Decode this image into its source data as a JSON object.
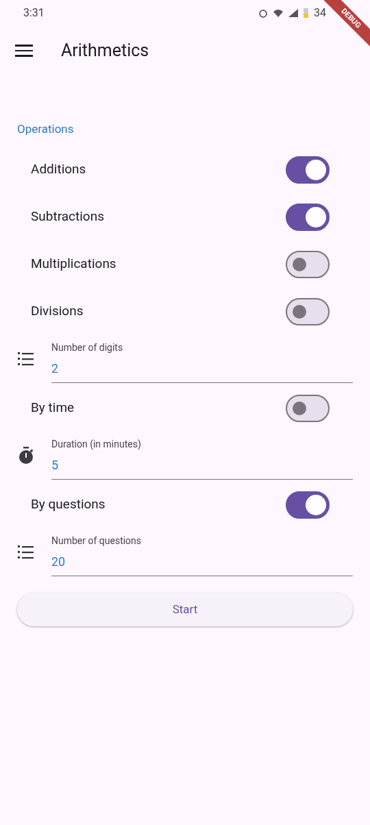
{
  "status_bar": {
    "time": "3:31",
    "battery": "34"
  },
  "debug_banner": {
    "label": "DEBUG"
  },
  "app_bar": {
    "title": "Arithmetics"
  },
  "section": {
    "title": "Operations"
  },
  "items": [
    {
      "kind": "switch",
      "label": "Additions",
      "on": true
    },
    {
      "kind": "switch",
      "label": "Subtractions",
      "on": true
    },
    {
      "kind": "switch",
      "label": "Multiplications",
      "on": false
    },
    {
      "kind": "switch",
      "label": "Divisions",
      "on": false
    },
    {
      "kind": "count_field",
      "label": "Number of digits",
      "value": "2"
    },
    {
      "kind": "switch",
      "label": "By time",
      "on": false
    },
    {
      "kind": "timer_field",
      "label": "Duration (in minutes)",
      "value": "5"
    },
    {
      "kind": "switch",
      "label": "By questions",
      "on": true
    },
    {
      "kind": "count_field",
      "label": "Number of questions",
      "value": "20"
    }
  ],
  "start_button": {
    "label": "Start"
  }
}
